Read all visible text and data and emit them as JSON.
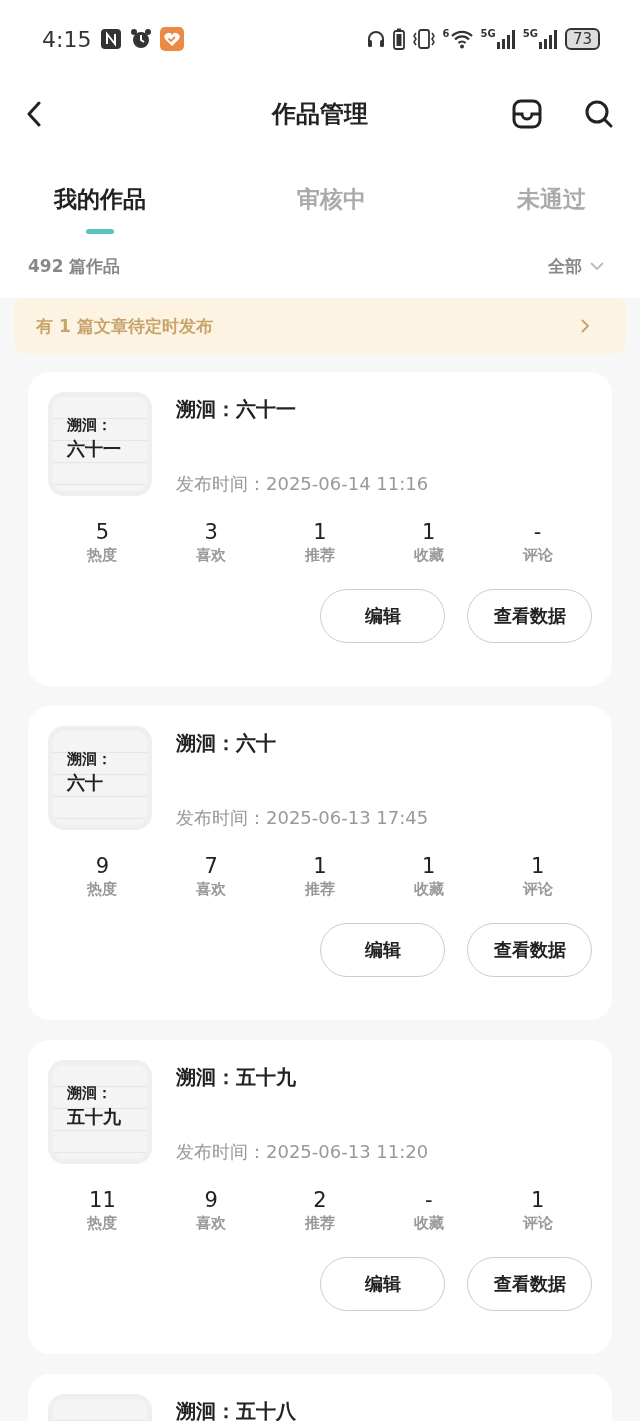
{
  "status_bar": {
    "time": "4:15",
    "wifi_badge": "6",
    "sim1": "5G",
    "sim2": "5G",
    "battery": "73"
  },
  "header": {
    "title": "作品管理"
  },
  "tabs": [
    {
      "label": "我的作品",
      "selected": true
    },
    {
      "label": "审核中",
      "selected": false
    },
    {
      "label": "未通过",
      "selected": false
    }
  ],
  "summary": {
    "count": "492 篇作品",
    "filter": "全部"
  },
  "notice": {
    "text": "有 1 篇文章待定时发布"
  },
  "works": [
    {
      "cover_lines": [
        "溯洄：",
        "六十一"
      ],
      "title": "溯洄：六十一",
      "published": "发布时间：2025-06-14 11:16",
      "stats": [
        {
          "value": "5",
          "label": "热度"
        },
        {
          "value": "3",
          "label": "喜欢"
        },
        {
          "value": "1",
          "label": "推荐"
        },
        {
          "value": "1",
          "label": "收藏"
        },
        {
          "value": "-",
          "label": "评论"
        }
      ],
      "buttons": [
        "编辑",
        "查看数据"
      ]
    },
    {
      "cover_lines": [
        "溯洄：",
        "六十"
      ],
      "title": "溯洄：六十",
      "published": "发布时间：2025-06-13 17:45",
      "stats": [
        {
          "value": "9",
          "label": "热度"
        },
        {
          "value": "7",
          "label": "喜欢"
        },
        {
          "value": "1",
          "label": "推荐"
        },
        {
          "value": "1",
          "label": "收藏"
        },
        {
          "value": "1",
          "label": "评论"
        }
      ],
      "buttons": [
        "编辑",
        "查看数据"
      ]
    },
    {
      "cover_lines": [
        "溯洄：",
        "五十九"
      ],
      "title": "溯洄：五十九",
      "published": "发布时间：2025-06-13 11:20",
      "stats": [
        {
          "value": "11",
          "label": "热度"
        },
        {
          "value": "9",
          "label": "喜欢"
        },
        {
          "value": "2",
          "label": "推荐"
        },
        {
          "value": "-",
          "label": "收藏"
        },
        {
          "value": "1",
          "label": "评论"
        }
      ],
      "buttons": [
        "编辑",
        "查看数据"
      ]
    },
    {
      "title": "溯洄：五十八"
    }
  ]
}
